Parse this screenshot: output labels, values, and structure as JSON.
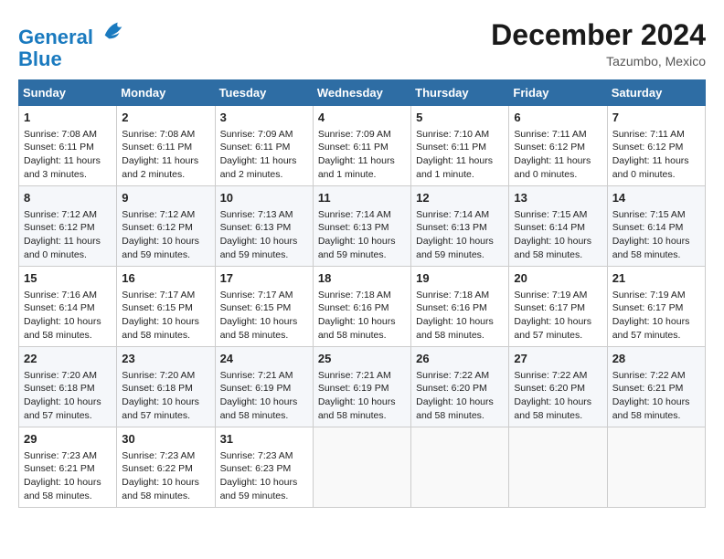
{
  "header": {
    "logo_line1": "General",
    "logo_line2": "Blue",
    "month_title": "December 2024",
    "location": "Tazumbo, Mexico"
  },
  "days_of_week": [
    "Sunday",
    "Monday",
    "Tuesday",
    "Wednesday",
    "Thursday",
    "Friday",
    "Saturday"
  ],
  "weeks": [
    [
      {
        "day": "1",
        "lines": [
          "Sunrise: 7:08 AM",
          "Sunset: 6:11 PM",
          "Daylight: 11 hours",
          "and 3 minutes."
        ]
      },
      {
        "day": "2",
        "lines": [
          "Sunrise: 7:08 AM",
          "Sunset: 6:11 PM",
          "Daylight: 11 hours",
          "and 2 minutes."
        ]
      },
      {
        "day": "3",
        "lines": [
          "Sunrise: 7:09 AM",
          "Sunset: 6:11 PM",
          "Daylight: 11 hours",
          "and 2 minutes."
        ]
      },
      {
        "day": "4",
        "lines": [
          "Sunrise: 7:09 AM",
          "Sunset: 6:11 PM",
          "Daylight: 11 hours",
          "and 1 minute."
        ]
      },
      {
        "day": "5",
        "lines": [
          "Sunrise: 7:10 AM",
          "Sunset: 6:11 PM",
          "Daylight: 11 hours",
          "and 1 minute."
        ]
      },
      {
        "day": "6",
        "lines": [
          "Sunrise: 7:11 AM",
          "Sunset: 6:12 PM",
          "Daylight: 11 hours",
          "and 0 minutes."
        ]
      },
      {
        "day": "7",
        "lines": [
          "Sunrise: 7:11 AM",
          "Sunset: 6:12 PM",
          "Daylight: 11 hours",
          "and 0 minutes."
        ]
      }
    ],
    [
      {
        "day": "8",
        "lines": [
          "Sunrise: 7:12 AM",
          "Sunset: 6:12 PM",
          "Daylight: 11 hours",
          "and 0 minutes."
        ]
      },
      {
        "day": "9",
        "lines": [
          "Sunrise: 7:12 AM",
          "Sunset: 6:12 PM",
          "Daylight: 10 hours",
          "and 59 minutes."
        ]
      },
      {
        "day": "10",
        "lines": [
          "Sunrise: 7:13 AM",
          "Sunset: 6:13 PM",
          "Daylight: 10 hours",
          "and 59 minutes."
        ]
      },
      {
        "day": "11",
        "lines": [
          "Sunrise: 7:14 AM",
          "Sunset: 6:13 PM",
          "Daylight: 10 hours",
          "and 59 minutes."
        ]
      },
      {
        "day": "12",
        "lines": [
          "Sunrise: 7:14 AM",
          "Sunset: 6:13 PM",
          "Daylight: 10 hours",
          "and 59 minutes."
        ]
      },
      {
        "day": "13",
        "lines": [
          "Sunrise: 7:15 AM",
          "Sunset: 6:14 PM",
          "Daylight: 10 hours",
          "and 58 minutes."
        ]
      },
      {
        "day": "14",
        "lines": [
          "Sunrise: 7:15 AM",
          "Sunset: 6:14 PM",
          "Daylight: 10 hours",
          "and 58 minutes."
        ]
      }
    ],
    [
      {
        "day": "15",
        "lines": [
          "Sunrise: 7:16 AM",
          "Sunset: 6:14 PM",
          "Daylight: 10 hours",
          "and 58 minutes."
        ]
      },
      {
        "day": "16",
        "lines": [
          "Sunrise: 7:17 AM",
          "Sunset: 6:15 PM",
          "Daylight: 10 hours",
          "and 58 minutes."
        ]
      },
      {
        "day": "17",
        "lines": [
          "Sunrise: 7:17 AM",
          "Sunset: 6:15 PM",
          "Daylight: 10 hours",
          "and 58 minutes."
        ]
      },
      {
        "day": "18",
        "lines": [
          "Sunrise: 7:18 AM",
          "Sunset: 6:16 PM",
          "Daylight: 10 hours",
          "and 58 minutes."
        ]
      },
      {
        "day": "19",
        "lines": [
          "Sunrise: 7:18 AM",
          "Sunset: 6:16 PM",
          "Daylight: 10 hours",
          "and 58 minutes."
        ]
      },
      {
        "day": "20",
        "lines": [
          "Sunrise: 7:19 AM",
          "Sunset: 6:17 PM",
          "Daylight: 10 hours",
          "and 57 minutes."
        ]
      },
      {
        "day": "21",
        "lines": [
          "Sunrise: 7:19 AM",
          "Sunset: 6:17 PM",
          "Daylight: 10 hours",
          "and 57 minutes."
        ]
      }
    ],
    [
      {
        "day": "22",
        "lines": [
          "Sunrise: 7:20 AM",
          "Sunset: 6:18 PM",
          "Daylight: 10 hours",
          "and 57 minutes."
        ]
      },
      {
        "day": "23",
        "lines": [
          "Sunrise: 7:20 AM",
          "Sunset: 6:18 PM",
          "Daylight: 10 hours",
          "and 57 minutes."
        ]
      },
      {
        "day": "24",
        "lines": [
          "Sunrise: 7:21 AM",
          "Sunset: 6:19 PM",
          "Daylight: 10 hours",
          "and 58 minutes."
        ]
      },
      {
        "day": "25",
        "lines": [
          "Sunrise: 7:21 AM",
          "Sunset: 6:19 PM",
          "Daylight: 10 hours",
          "and 58 minutes."
        ]
      },
      {
        "day": "26",
        "lines": [
          "Sunrise: 7:22 AM",
          "Sunset: 6:20 PM",
          "Daylight: 10 hours",
          "and 58 minutes."
        ]
      },
      {
        "day": "27",
        "lines": [
          "Sunrise: 7:22 AM",
          "Sunset: 6:20 PM",
          "Daylight: 10 hours",
          "and 58 minutes."
        ]
      },
      {
        "day": "28",
        "lines": [
          "Sunrise: 7:22 AM",
          "Sunset: 6:21 PM",
          "Daylight: 10 hours",
          "and 58 minutes."
        ]
      }
    ],
    [
      {
        "day": "29",
        "lines": [
          "Sunrise: 7:23 AM",
          "Sunset: 6:21 PM",
          "Daylight: 10 hours",
          "and 58 minutes."
        ]
      },
      {
        "day": "30",
        "lines": [
          "Sunrise: 7:23 AM",
          "Sunset: 6:22 PM",
          "Daylight: 10 hours",
          "and 58 minutes."
        ]
      },
      {
        "day": "31",
        "lines": [
          "Sunrise: 7:23 AM",
          "Sunset: 6:23 PM",
          "Daylight: 10 hours",
          "and 59 minutes."
        ]
      },
      {
        "day": "",
        "lines": []
      },
      {
        "day": "",
        "lines": []
      },
      {
        "day": "",
        "lines": []
      },
      {
        "day": "",
        "lines": []
      }
    ]
  ]
}
